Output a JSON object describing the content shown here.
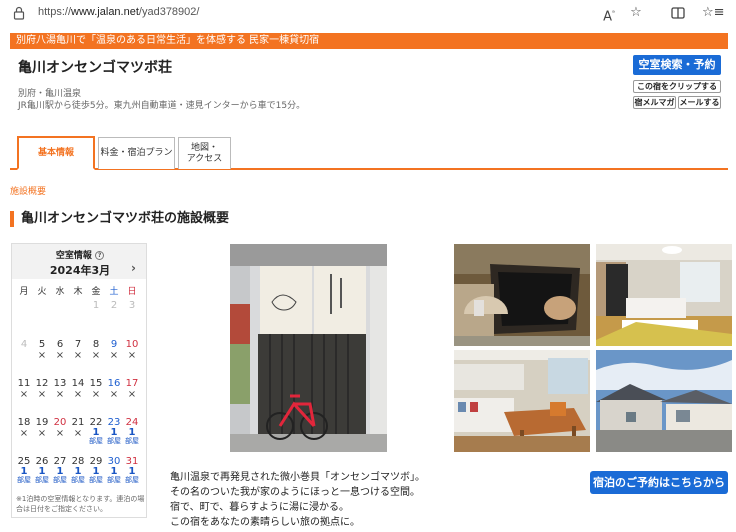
{
  "browser": {
    "url_prefix": "https://",
    "url_host": "www.jalan.net",
    "url_path": "/yad378902/"
  },
  "header": {
    "banner": "別府八湯亀川で「温泉のある日常生活」を体感する 民家一棟貸切宿",
    "name": "亀川オンセンゴマツボ荘",
    "area": "別府・亀川温泉",
    "access": "JR亀川駅から徒歩5分。東九州自動車道・速見インターから車で15分。",
    "search_button": "空室検索・予約",
    "clip_button": "この宿をクリップする",
    "mag_button": "宿メルマガ",
    "mail_button": "メールする"
  },
  "tabs": [
    {
      "label": "基本情報"
    },
    {
      "label": "料金・宿泊プラン"
    },
    {
      "label": "地図・\nアクセス"
    }
  ],
  "breadcrumb": "施設概要",
  "section_title": "亀川オンセンゴマツボ荘の施設概要",
  "calendar": {
    "title": "空室情報",
    "month": "2024年3月",
    "weekdays": [
      "月",
      "火",
      "水",
      "木",
      "金",
      "土",
      "日"
    ],
    "mark": "×",
    "rooms_unit": "部屋",
    "note": "※1泊時の空室情報となります。連泊の場合は日付をご指定ください。",
    "weeks": [
      [
        null,
        null,
        null,
        null,
        {
          "d": "1",
          "s": "past"
        },
        {
          "d": "2",
          "s": "past"
        },
        {
          "d": "3",
          "s": "past"
        }
      ],
      [
        {
          "d": "4",
          "s": "past"
        },
        {
          "d": "5",
          "s": "x"
        },
        {
          "d": "6",
          "s": "x"
        },
        {
          "d": "7",
          "s": "x"
        },
        {
          "d": "8",
          "s": "x"
        },
        {
          "d": "9",
          "s": "x"
        },
        {
          "d": "10",
          "s": "x"
        }
      ],
      [
        {
          "d": "11",
          "s": "x"
        },
        {
          "d": "12",
          "s": "x"
        },
        {
          "d": "13",
          "s": "x"
        },
        {
          "d": "14",
          "s": "x"
        },
        {
          "d": "15",
          "s": "x"
        },
        {
          "d": "16",
          "s": "x"
        },
        {
          "d": "17",
          "s": "x"
        }
      ],
      [
        {
          "d": "18",
          "s": "x"
        },
        {
          "d": "19",
          "s": "x"
        },
        {
          "d": "20",
          "s": "x"
        },
        {
          "d": "21",
          "s": "x"
        },
        {
          "d": "22",
          "s": "r",
          "n": "1"
        },
        {
          "d": "23",
          "s": "r",
          "n": "1"
        },
        {
          "d": "24",
          "s": "r",
          "n": "1"
        }
      ],
      [
        {
          "d": "25",
          "s": "r",
          "n": "1"
        },
        {
          "d": "26",
          "s": "r",
          "n": "1"
        },
        {
          "d": "27",
          "s": "r",
          "n": "1"
        },
        {
          "d": "28",
          "s": "r",
          "n": "1"
        },
        {
          "d": "29",
          "s": "r",
          "n": "1"
        },
        {
          "d": "30",
          "s": "r",
          "n": "1"
        },
        {
          "d": "31",
          "s": "r",
          "n": "1"
        }
      ]
    ]
  },
  "description": [
    "亀川温泉で再発見された微小巻貝「オンセンゴマツボ」。",
    "その名のついた我が家のようにほっと一息つける空間。",
    "宿で、町で、暮らすように湯に浸かる。",
    "この宿をあなたの素晴らしい旅の拠点に。"
  ],
  "book_button": "宿泊のご予約はこちらから",
  "colors": {
    "accent": "#f37321",
    "blue": "#1a6bd6"
  }
}
